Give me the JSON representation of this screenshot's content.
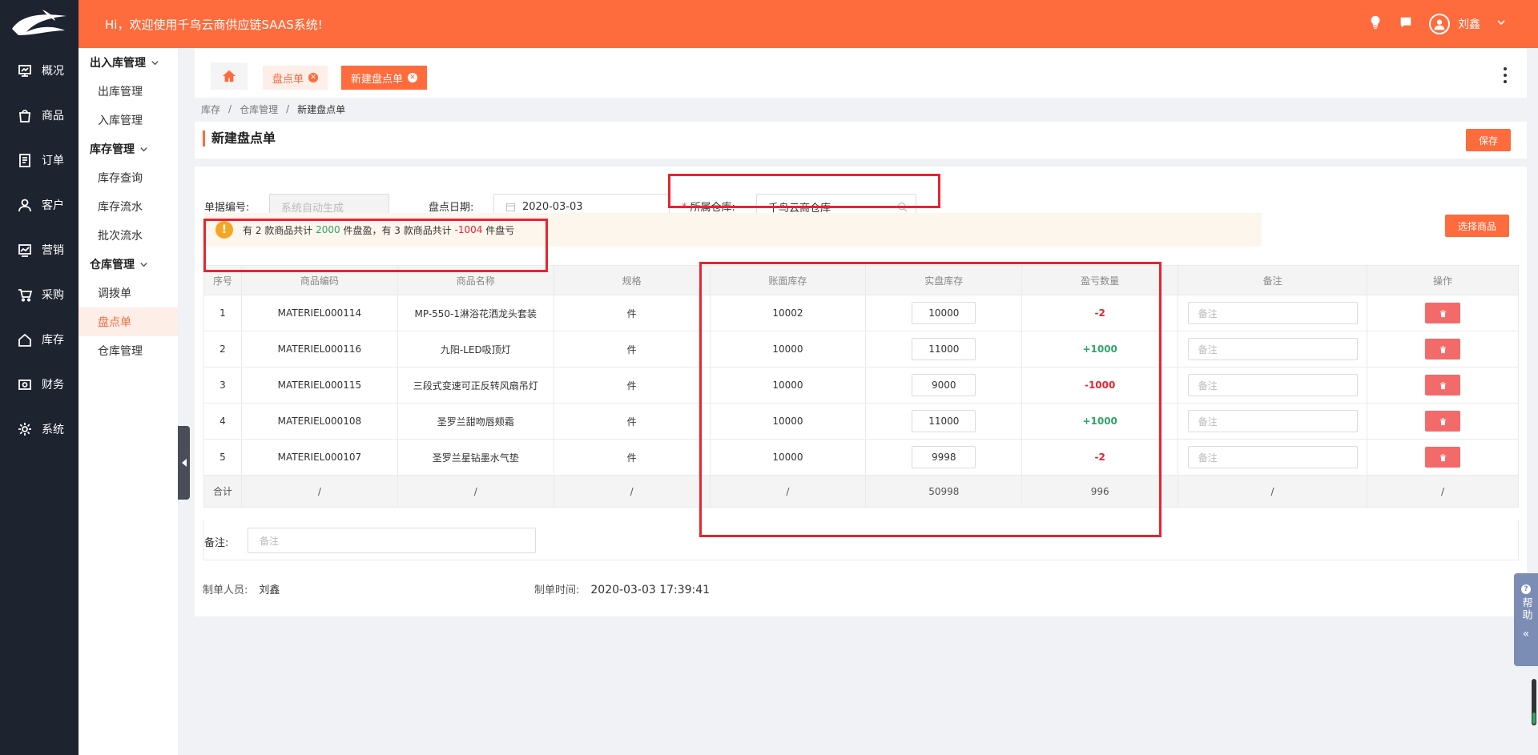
{
  "header": {
    "welcome": "Hi，欢迎使用千鸟云商供应链SAAS系统!",
    "username": "刘鑫"
  },
  "leftnav": {
    "items": [
      {
        "label": "概况",
        "icon": "chart-icon"
      },
      {
        "label": "商品",
        "icon": "bag-icon"
      },
      {
        "label": "订单",
        "icon": "document-icon"
      },
      {
        "label": "客户",
        "icon": "user-icon"
      },
      {
        "label": "营销",
        "icon": "trend-icon"
      },
      {
        "label": "采购",
        "icon": "cart-icon"
      },
      {
        "label": "库存",
        "icon": "house-icon"
      },
      {
        "label": "财务",
        "icon": "money-icon"
      },
      {
        "label": "系统",
        "icon": "gear-icon"
      }
    ]
  },
  "submenu": {
    "groups": [
      {
        "title": "出入库管理",
        "items": [
          "出库管理",
          "入库管理"
        ]
      },
      {
        "title": "库存管理",
        "items": [
          "库存查询",
          "库存流水",
          "批次流水"
        ]
      },
      {
        "title": "仓库管理",
        "items": [
          "调拨单",
          "盘点单",
          "仓库管理"
        ]
      }
    ],
    "active": "盘点单"
  },
  "tabs": {
    "items": [
      "盘点单",
      "新建盘点单"
    ],
    "active": "新建盘点单"
  },
  "breadcrumb": [
    "库存",
    "仓库管理",
    "新建盘点单"
  ],
  "page": {
    "title": "新建盘点单",
    "save_label": "保存",
    "choose_goods_label": "选择商品"
  },
  "form": {
    "doc_no_label": "单据编号:",
    "doc_no_placeholder": "系统自动生成",
    "date_label": "盘点日期:",
    "date_value": "2020-03-03",
    "warehouse_label": "所属仓库:",
    "warehouse_value": "千鸟云商仓库",
    "remark_label": "备注:",
    "remark_placeholder": "备注",
    "maker_label": "制单人员:",
    "maker_value": "刘鑫",
    "time_label": "制单时间:",
    "time_value": "2020-03-03 17:39:41"
  },
  "alert": {
    "p1": "有 2 款商品共计 ",
    "surplus": "2000",
    "p2": " 件盘盈，有 3 款商品共计 ",
    "loss": "-1004",
    "p3": " 件盘亏"
  },
  "table": {
    "headers": [
      "序号",
      "商品编码",
      "商品名称",
      "规格",
      "账面库存",
      "实盘库存",
      "盈亏数量",
      "备注",
      "操作"
    ],
    "rows": [
      {
        "no": "1",
        "code": "MATERIEL000114",
        "name": "MP-550-1淋浴花洒龙头套装",
        "spec": "件",
        "book": "10002",
        "actual": "10000",
        "diff": "-2",
        "remark_ph": "备注"
      },
      {
        "no": "2",
        "code": "MATERIEL000116",
        "name": "九阳-LED吸顶灯",
        "spec": "件",
        "book": "10000",
        "actual": "11000",
        "diff": "+1000",
        "remark_ph": "备注"
      },
      {
        "no": "3",
        "code": "MATERIEL000115",
        "name": "三段式变速可正反转风扇吊灯",
        "spec": "件",
        "book": "10000",
        "actual": "9000",
        "diff": "-1000",
        "remark_ph": "备注"
      },
      {
        "no": "4",
        "code": "MATERIEL000108",
        "name": "圣罗兰甜吻唇颊霜",
        "spec": "件",
        "book": "10000",
        "actual": "11000",
        "diff": "+1000",
        "remark_ph": "备注"
      },
      {
        "no": "5",
        "code": "MATERIEL000107",
        "name": "圣罗兰星钻墨水气垫",
        "spec": "件",
        "book": "10000",
        "actual": "9998",
        "diff": "-2",
        "remark_ph": "备注"
      }
    ],
    "sum": {
      "label": "合计",
      "slash": "/",
      "actual_total": "50998",
      "diff_total": "996"
    }
  },
  "help": {
    "label": "帮助",
    "collapse": "«"
  },
  "colors": {
    "brand": "#fe6b3c",
    "nav_bg": "#1e2330",
    "surplus": "#2fa566",
    "loss": "#e8242f",
    "highlight": "#e8242f"
  }
}
